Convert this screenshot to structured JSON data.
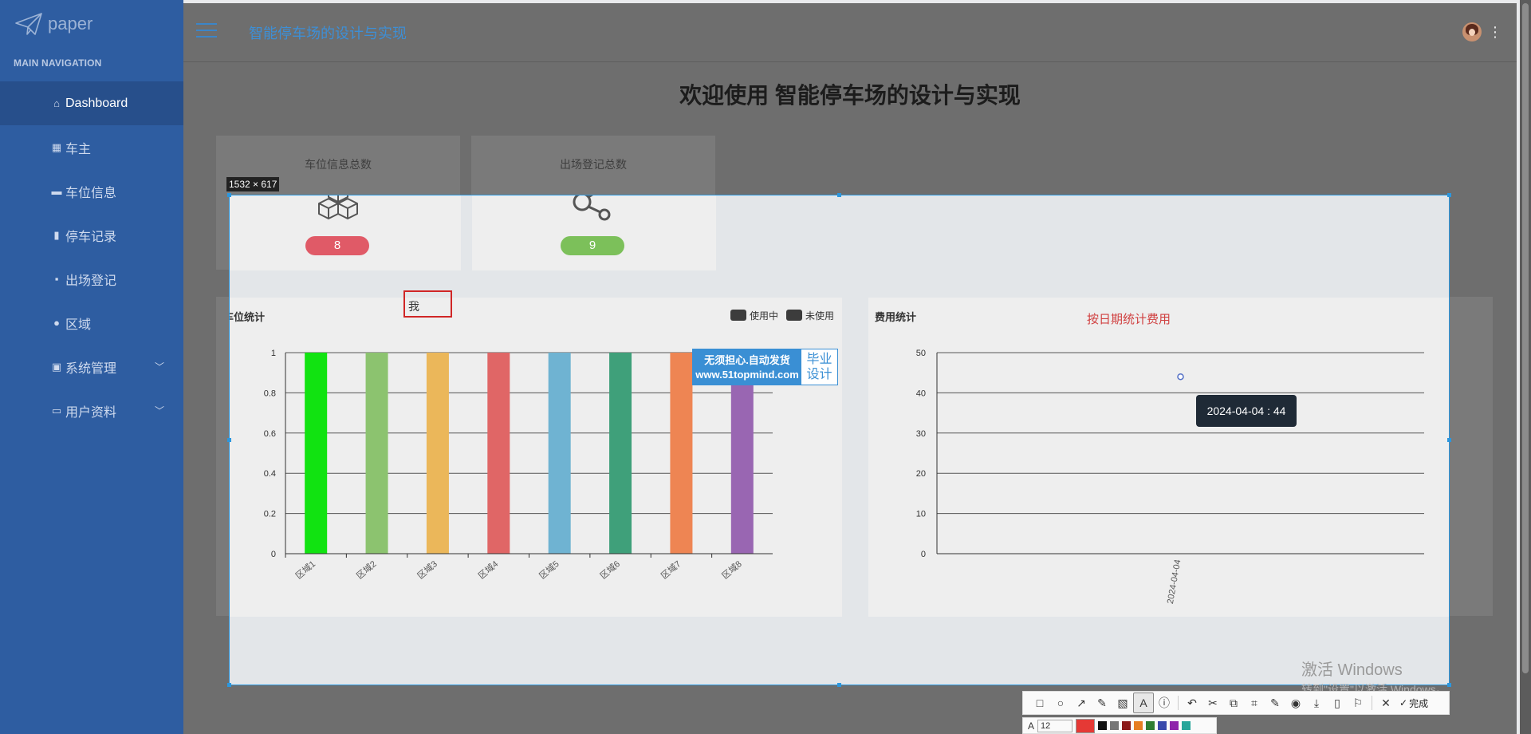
{
  "brand": {
    "name": "paper"
  },
  "sidebar": {
    "header": "MAIN NAVIGATION",
    "items": [
      {
        "label": "Dashboard",
        "icon": "home-icon",
        "active": true
      },
      {
        "label": "车主",
        "icon": "grid-icon"
      },
      {
        "label": "车位信息",
        "icon": "briefcase-icon"
      },
      {
        "label": "停车记录",
        "icon": "bar-chart-icon"
      },
      {
        "label": "出场登记",
        "icon": "comment-icon"
      },
      {
        "label": "区域",
        "icon": "user-icon"
      },
      {
        "label": "系统管理",
        "icon": "image-icon",
        "expandable": true
      },
      {
        "label": "用户资料",
        "icon": "calendar-icon",
        "expandable": true
      }
    ]
  },
  "header": {
    "title": "智能停车场的设计与实现"
  },
  "main": {
    "welcome": "欢迎使用 智能停车场的设计与实现",
    "stats": [
      {
        "label": "车位信息总数",
        "value": "8",
        "color": "#e05a67",
        "icon": "cubes-icon"
      },
      {
        "label": "出场登记总数",
        "value": "9",
        "color": "#7cc05a",
        "icon": "share-icon"
      }
    ]
  },
  "selection": {
    "size_label": "1532 × 617"
  },
  "text_tool": {
    "value": "我"
  },
  "ad": {
    "line1": "无须担心.自动发货",
    "line2": "www.51topmind.com",
    "right1": "毕业",
    "right2": "设计"
  },
  "parking_chart": {
    "title": "车位统计",
    "legend": [
      "使用中",
      "未使用"
    ]
  },
  "fee_chart": {
    "title": "费用统计",
    "subtitle": "按日期统计费用",
    "tooltip": "2024-04-04 : 44"
  },
  "chart_data": [
    {
      "type": "bar",
      "title": "车位统计",
      "categories": [
        "区域1",
        "区域2",
        "区域3",
        "区域4",
        "区域5",
        "区域6",
        "区域7",
        "区域8"
      ],
      "values": [
        1,
        1,
        1,
        1,
        1,
        1,
        1,
        1
      ],
      "colors": [
        "#11e311",
        "#8cc36f",
        "#ebb75a",
        "#e06666",
        "#6fb3d2",
        "#3fa07a",
        "#ee8553",
        "#9966b2"
      ],
      "yticks": [
        "0",
        "0.2",
        "0.4",
        "0.6",
        "0.8",
        "1"
      ],
      "ylim": [
        0,
        1
      ],
      "legend": [
        "使用中",
        "未使用"
      ]
    },
    {
      "type": "scatter",
      "title": "费用统计",
      "subtitle": "按日期统计费用",
      "x": [
        "2024-04-04"
      ],
      "values": [
        44
      ],
      "yticks": [
        "0",
        "10",
        "20",
        "30",
        "40",
        "50"
      ],
      "ylim": [
        0,
        50
      ]
    }
  ],
  "watermark": {
    "line1": "激活 Windows",
    "line2": "转到\"设置\"以激活 Windows。"
  },
  "toolbar": {
    "done_label": "完成",
    "font_size": "12"
  },
  "palette_colors": [
    "#e53935",
    "#111111",
    "#777777",
    "#8b1a1a",
    "#e67e22",
    "#2e7d32",
    "#3949ab",
    "#8e24aa",
    "#26a69a"
  ]
}
